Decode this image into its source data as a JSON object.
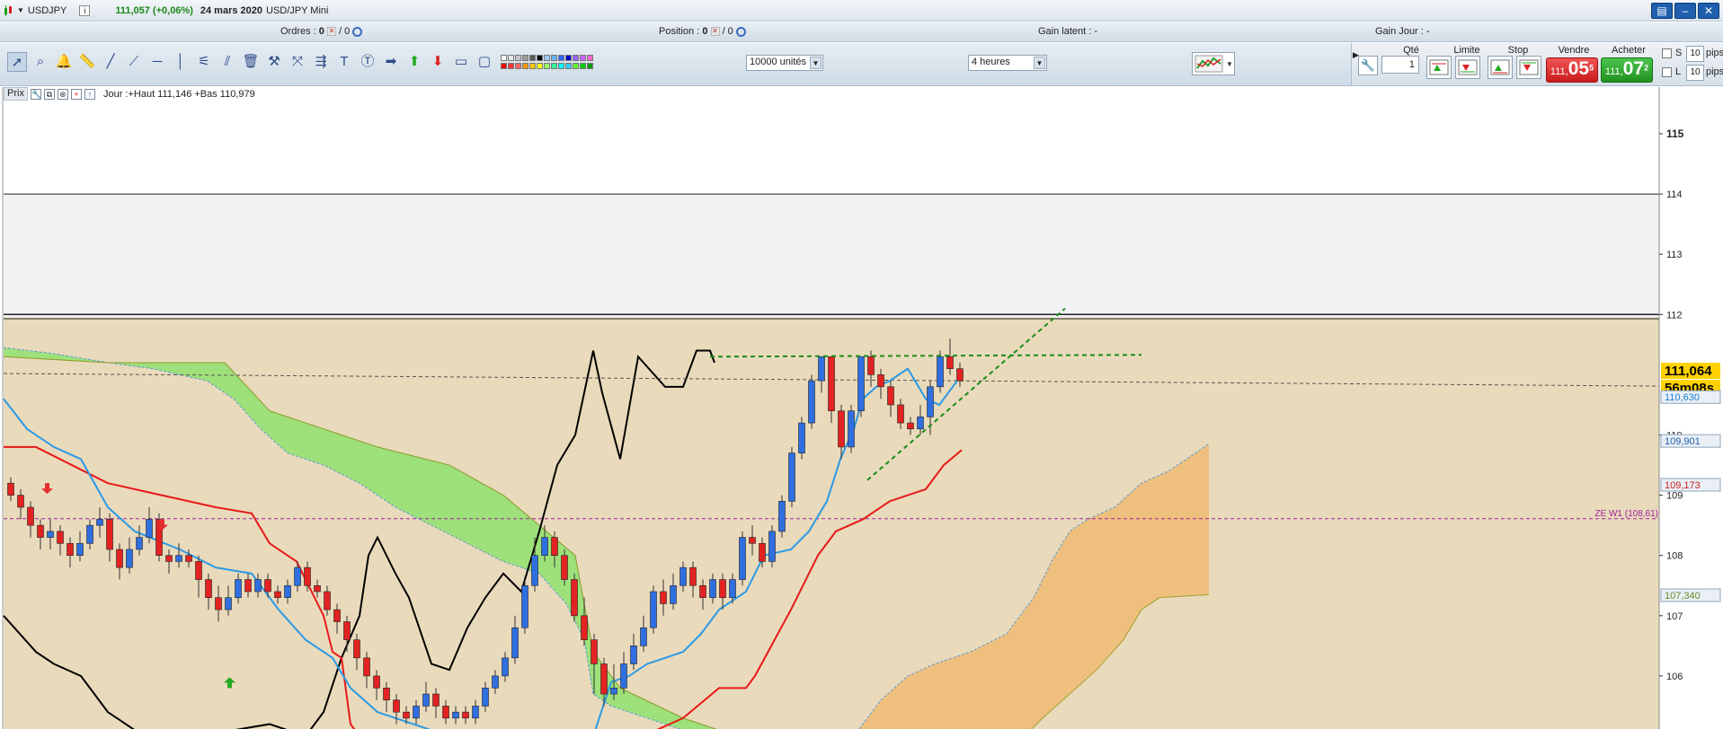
{
  "window": {
    "symbol": "USDJPY",
    "price_change": "111,057 (+0,06%)",
    "date": "24 mars 2020",
    "instrument": "USD/JPY Mini",
    "info_icon": "i",
    "buttons": [
      "▤",
      "–",
      "✕"
    ]
  },
  "infobar": {
    "ordres_label": "Ordres :",
    "ordres_value": "0",
    "ordres_total": "/ 0",
    "position_label": "Position :",
    "position_value": "0",
    "position_total": "/ 0",
    "gain_latent": "Gain latent : -",
    "gain_jour": "Gain Jour : -"
  },
  "toolbar": {
    "units": "10000 unités",
    "timeframe": "4 heures",
    "colors": {
      "row1": [
        "#ffffff",
        "#e6e6e6",
        "#c8c8c8",
        "#9a9a9a",
        "#5a5a5a",
        "#000000",
        "#99ccff",
        "#66b3ff",
        "#3366ff",
        "#0000cc",
        "#9966ff",
        "#cc66ff",
        "#ff66cc"
      ],
      "row2": [
        "#ff0000",
        "#ff3333",
        "#ff6666",
        "#ff9900",
        "#ffcc00",
        "#ffff00",
        "#99ff66",
        "#33ff99",
        "#00ffff",
        "#33ccff",
        "#66ff33",
        "#00cc00",
        "#009900"
      ]
    }
  },
  "trading": {
    "qte_label": "Qté",
    "qte_value": "1",
    "limite_label": "Limite",
    "stop_label": "Stop",
    "vendre_label": "Vendre",
    "vendre_small": "111,",
    "vendre_big": "05",
    "vendre_sup": "5",
    "acheter_label": "Acheter",
    "acheter_small": "111,",
    "acheter_big": "07",
    "acheter_sup": "2",
    "s_label": "S",
    "l_label": "L",
    "pips_s": "10",
    "pips_l": "10",
    "pips_unit": "pips"
  },
  "legend": {
    "prix": "Prix",
    "ohl": "Jour :+Haut 111,146 +Bas 110,979"
  },
  "chart_data": {
    "type": "candlestick",
    "title": "",
    "y_axis_labels": [
      "115",
      "114",
      "113",
      "112",
      "110",
      "109",
      "108",
      "107",
      "106"
    ],
    "ylim": [
      105.15,
      115.8
    ],
    "horizontal_lines": [
      {
        "label": "ZE W1 (108,61)",
        "value": 108.61,
        "color": "#a020a0",
        "style": "dashed"
      }
    ],
    "price_tags": [
      {
        "text": "111,064",
        "value": 111.064,
        "bg": "#ffd100",
        "fg": "#000000",
        "bold": true
      },
      {
        "text": "56m08s",
        "value": 110.78,
        "bg": "#ffd100",
        "fg": "#000000",
        "bold": true
      },
      {
        "text": "110,630",
        "value": 110.63,
        "bg": "#e9eff5",
        "fg": "#1e7fd6",
        "bold": false
      },
      {
        "text": "109,901",
        "value": 109.901,
        "bg": "#e9eff5",
        "fg": "#1f5fae",
        "bold": false
      },
      {
        "text": "109,173",
        "value": 109.173,
        "bg": "#e9eff5",
        "fg": "#cc2020",
        "bold": false
      },
      {
        "text": "107,340",
        "value": 107.34,
        "bg": "#e9eff5",
        "fg": "#6a8a2a",
        "bold": false
      }
    ],
    "candles": [
      [
        109.2,
        109.0,
        109.3,
        108.9
      ],
      [
        109.0,
        108.8,
        109.1,
        108.6
      ],
      [
        108.8,
        108.5,
        108.9,
        108.3
      ],
      [
        108.5,
        108.3,
        108.6,
        108.1
      ],
      [
        108.3,
        108.4,
        108.6,
        108.1
      ],
      [
        108.4,
        108.2,
        108.5,
        108.0
      ],
      [
        108.2,
        108.0,
        108.3,
        107.8
      ],
      [
        108.0,
        108.2,
        108.4,
        107.9
      ],
      [
        108.2,
        108.5,
        108.6,
        108.1
      ],
      [
        108.5,
        108.6,
        108.8,
        108.3
      ],
      [
        108.6,
        108.1,
        108.7,
        107.9
      ],
      [
        108.1,
        107.8,
        108.2,
        107.6
      ],
      [
        107.8,
        108.1,
        108.3,
        107.7
      ],
      [
        108.1,
        108.3,
        108.5,
        108.0
      ],
      [
        108.3,
        108.6,
        108.8,
        108.2
      ],
      [
        108.6,
        108.0,
        108.7,
        107.9
      ],
      [
        108.0,
        107.9,
        108.1,
        107.7
      ],
      [
        107.9,
        108.0,
        108.2,
        107.8
      ],
      [
        108.0,
        107.9,
        108.1,
        107.8
      ],
      [
        107.9,
        107.6,
        108.0,
        107.3
      ],
      [
        107.6,
        107.3,
        107.7,
        107.1
      ],
      [
        107.3,
        107.1,
        107.5,
        106.9
      ],
      [
        107.1,
        107.3,
        107.5,
        107.0
      ],
      [
        107.3,
        107.6,
        107.7,
        107.2
      ],
      [
        107.6,
        107.4,
        107.7,
        107.3
      ],
      [
        107.4,
        107.6,
        107.7,
        107.3
      ],
      [
        107.6,
        107.4,
        107.7,
        107.3
      ],
      [
        107.4,
        107.3,
        107.5,
        107.2
      ],
      [
        107.3,
        107.5,
        107.6,
        107.2
      ],
      [
        107.5,
        107.8,
        107.9,
        107.4
      ],
      [
        107.8,
        107.5,
        107.9,
        107.4
      ],
      [
        107.5,
        107.4,
        107.6,
        107.3
      ],
      [
        107.4,
        107.1,
        107.5,
        107.0
      ],
      [
        107.1,
        106.9,
        107.2,
        106.7
      ],
      [
        106.9,
        106.6,
        107.0,
        106.4
      ],
      [
        106.6,
        106.3,
        106.7,
        106.1
      ],
      [
        106.3,
        106.0,
        106.4,
        105.8
      ],
      [
        106.0,
        105.8,
        106.1,
        105.6
      ],
      [
        105.8,
        105.6,
        105.9,
        105.4
      ],
      [
        105.6,
        105.4,
        105.7,
        105.2
      ],
      [
        105.4,
        105.3,
        105.5,
        105.2
      ],
      [
        105.3,
        105.5,
        105.6,
        105.2
      ],
      [
        105.5,
        105.7,
        105.9,
        105.4
      ],
      [
        105.7,
        105.5,
        105.8,
        105.3
      ],
      [
        105.5,
        105.3,
        105.6,
        105.2
      ],
      [
        105.3,
        105.4,
        105.5,
        105.2
      ],
      [
        105.4,
        105.3,
        105.5,
        105.2
      ],
      [
        105.3,
        105.5,
        105.6,
        105.2
      ],
      [
        105.5,
        105.8,
        105.9,
        105.4
      ],
      [
        105.8,
        106.0,
        106.1,
        105.7
      ],
      [
        106.0,
        106.3,
        106.4,
        105.9
      ],
      [
        106.3,
        106.8,
        107.0,
        106.2
      ],
      [
        106.8,
        107.5,
        107.6,
        106.7
      ],
      [
        107.5,
        108.0,
        108.3,
        107.4
      ],
      [
        108.0,
        108.3,
        108.5,
        107.9
      ],
      [
        108.3,
        108.0,
        108.4,
        107.8
      ],
      [
        108.0,
        107.6,
        108.1,
        107.5
      ],
      [
        107.6,
        107.0,
        107.7,
        106.9
      ],
      [
        107.0,
        106.6,
        107.3,
        106.5
      ],
      [
        106.6,
        106.2,
        106.7,
        105.7
      ],
      [
        106.2,
        105.7,
        106.3,
        105.5
      ],
      [
        105.7,
        105.8,
        106.2,
        105.6
      ],
      [
        105.8,
        106.2,
        106.4,
        105.7
      ],
      [
        106.2,
        106.5,
        106.7,
        106.1
      ],
      [
        106.5,
        106.8,
        107.0,
        106.4
      ],
      [
        106.8,
        107.4,
        107.5,
        106.7
      ],
      [
        107.4,
        107.2,
        107.6,
        107.0
      ],
      [
        107.2,
        107.5,
        107.7,
        107.1
      ],
      [
        107.5,
        107.8,
        107.9,
        107.4
      ],
      [
        107.8,
        107.5,
        107.9,
        107.3
      ],
      [
        107.5,
        107.3,
        107.6,
        107.1
      ],
      [
        107.3,
        107.6,
        107.7,
        107.2
      ],
      [
        107.6,
        107.3,
        107.7,
        107.1
      ],
      [
        107.3,
        107.6,
        107.7,
        107.2
      ],
      [
        107.6,
        108.3,
        108.4,
        107.5
      ],
      [
        108.3,
        108.2,
        108.5,
        108.0
      ],
      [
        108.2,
        107.9,
        108.3,
        107.8
      ],
      [
        107.9,
        108.4,
        108.5,
        107.8
      ],
      [
        108.4,
        108.9,
        109.0,
        108.3
      ],
      [
        108.9,
        109.7,
        109.8,
        108.8
      ],
      [
        109.7,
        110.2,
        110.3,
        109.6
      ],
      [
        110.2,
        110.9,
        111.0,
        110.1
      ],
      [
        110.9,
        111.3,
        111.3,
        110.7
      ],
      [
        111.3,
        110.4,
        111.3,
        110.2
      ],
      [
        110.4,
        109.8,
        110.5,
        109.6
      ],
      [
        109.8,
        110.4,
        110.5,
        109.7
      ],
      [
        110.4,
        111.3,
        111.3,
        110.3
      ],
      [
        111.3,
        111.0,
        111.4,
        110.8
      ],
      [
        111.0,
        110.8,
        111.1,
        110.6
      ],
      [
        110.8,
        110.5,
        110.9,
        110.3
      ],
      [
        110.5,
        110.2,
        110.6,
        110.1
      ],
      [
        110.2,
        110.1,
        110.3,
        110.0
      ],
      [
        110.1,
        110.3,
        110.5,
        110.0
      ],
      [
        110.3,
        110.8,
        110.9,
        110.0
      ],
      [
        110.8,
        111.3,
        111.4,
        110.7
      ],
      [
        111.3,
        111.1,
        111.6,
        111.0
      ],
      [
        111.1,
        110.9,
        111.2,
        110.8
      ]
    ]
  }
}
